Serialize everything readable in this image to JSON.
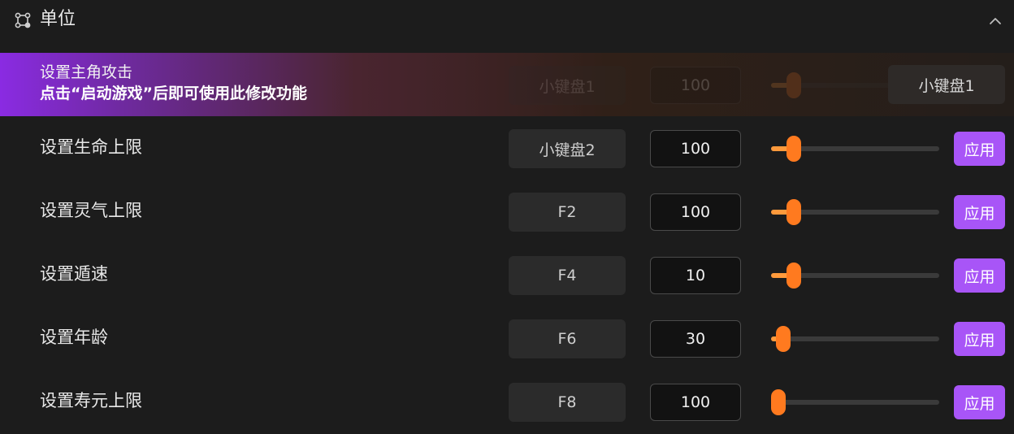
{
  "header": {
    "title": "单位",
    "icon": "units-icon",
    "collapse_icon": "chevron-up-icon"
  },
  "colors": {
    "accent": "#a855f7",
    "slider_thumb": "#ff7a1f",
    "slider_fill": "#ff9a3c",
    "highlight_start": "#8a2be2"
  },
  "rows": [
    {
      "label": "设置主角攻击",
      "hint": "点击“启动游戏”后即可使用此修改功能",
      "hotkey": "小键盘1",
      "value": "100",
      "slider_fraction": 0.09,
      "action_label": "小键盘1",
      "highlighted": true
    },
    {
      "label": "设置生命上限",
      "hotkey": "小键盘2",
      "value": "100",
      "slider_fraction": 0.09,
      "action_label": "应用"
    },
    {
      "label": "设置灵气上限",
      "hotkey": "F2",
      "value": "100",
      "slider_fraction": 0.09,
      "action_label": "应用"
    },
    {
      "label": "设置遁速",
      "hotkey": "F4",
      "value": "10",
      "slider_fraction": 0.09,
      "action_label": "应用"
    },
    {
      "label": "设置年龄",
      "hotkey": "F6",
      "value": "30",
      "slider_fraction": 0.03,
      "action_label": "应用"
    },
    {
      "label": "设置寿元上限",
      "hotkey": "F8",
      "value": "100",
      "slider_fraction": 0.0,
      "action_label": "应用"
    }
  ]
}
